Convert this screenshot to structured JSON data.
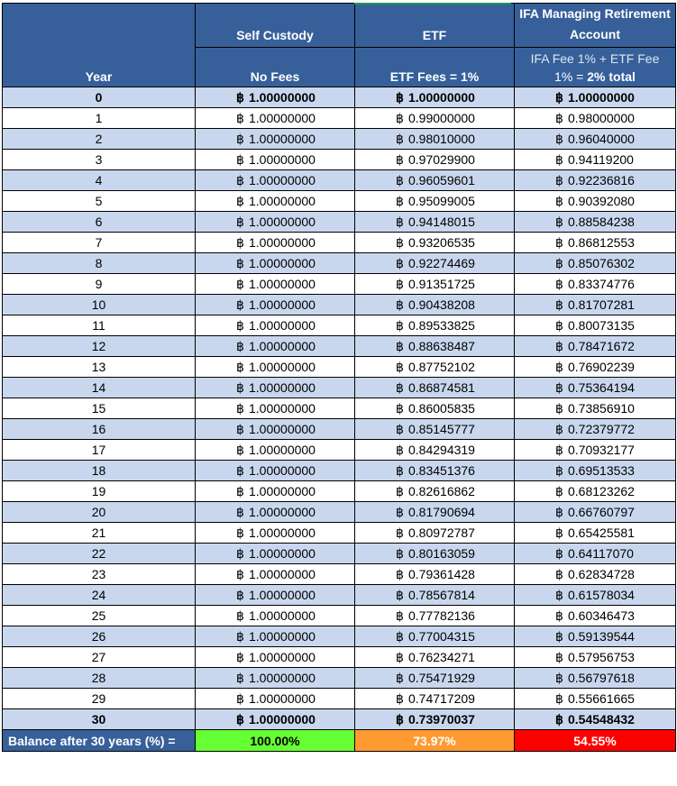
{
  "headers": {
    "year": "Year",
    "self_custody": "Self Custody",
    "self_custody_sub": "No Fees",
    "etf": "ETF",
    "etf_sub": "ETF Fees = 1%",
    "ifa": "IFA Managing Retirement Account",
    "ifa_sub_a": "IFA Fee 1% + ETF Fee",
    "ifa_sub_b": "1% = ",
    "ifa_sub_bold": "2% total"
  },
  "currency_symbol": "฿",
  "rows": [
    {
      "year": "0",
      "self": "1.00000000",
      "etf": "1.00000000",
      "ifa": "1.00000000"
    },
    {
      "year": "1",
      "self": "1.00000000",
      "etf": "0.99000000",
      "ifa": "0.98000000"
    },
    {
      "year": "2",
      "self": "1.00000000",
      "etf": "0.98010000",
      "ifa": "0.96040000"
    },
    {
      "year": "3",
      "self": "1.00000000",
      "etf": "0.97029900",
      "ifa": "0.94119200"
    },
    {
      "year": "4",
      "self": "1.00000000",
      "etf": "0.96059601",
      "ifa": "0.92236816"
    },
    {
      "year": "5",
      "self": "1.00000000",
      "etf": "0.95099005",
      "ifa": "0.90392080"
    },
    {
      "year": "6",
      "self": "1.00000000",
      "etf": "0.94148015",
      "ifa": "0.88584238"
    },
    {
      "year": "7",
      "self": "1.00000000",
      "etf": "0.93206535",
      "ifa": "0.86812553"
    },
    {
      "year": "8",
      "self": "1.00000000",
      "etf": "0.92274469",
      "ifa": "0.85076302"
    },
    {
      "year": "9",
      "self": "1.00000000",
      "etf": "0.91351725",
      "ifa": "0.83374776"
    },
    {
      "year": "10",
      "self": "1.00000000",
      "etf": "0.90438208",
      "ifa": "0.81707281"
    },
    {
      "year": "11",
      "self": "1.00000000",
      "etf": "0.89533825",
      "ifa": "0.80073135"
    },
    {
      "year": "12",
      "self": "1.00000000",
      "etf": "0.88638487",
      "ifa": "0.78471672"
    },
    {
      "year": "13",
      "self": "1.00000000",
      "etf": "0.87752102",
      "ifa": "0.76902239"
    },
    {
      "year": "14",
      "self": "1.00000000",
      "etf": "0.86874581",
      "ifa": "0.75364194"
    },
    {
      "year": "15",
      "self": "1.00000000",
      "etf": "0.86005835",
      "ifa": "0.73856910"
    },
    {
      "year": "16",
      "self": "1.00000000",
      "etf": "0.85145777",
      "ifa": "0.72379772"
    },
    {
      "year": "17",
      "self": "1.00000000",
      "etf": "0.84294319",
      "ifa": "0.70932177"
    },
    {
      "year": "18",
      "self": "1.00000000",
      "etf": "0.83451376",
      "ifa": "0.69513533"
    },
    {
      "year": "19",
      "self": "1.00000000",
      "etf": "0.82616862",
      "ifa": "0.68123262"
    },
    {
      "year": "20",
      "self": "1.00000000",
      "etf": "0.81790694",
      "ifa": "0.66760797"
    },
    {
      "year": "21",
      "self": "1.00000000",
      "etf": "0.80972787",
      "ifa": "0.65425581"
    },
    {
      "year": "22",
      "self": "1.00000000",
      "etf": "0.80163059",
      "ifa": "0.64117070"
    },
    {
      "year": "23",
      "self": "1.00000000",
      "etf": "0.79361428",
      "ifa": "0.62834728"
    },
    {
      "year": "24",
      "self": "1.00000000",
      "etf": "0.78567814",
      "ifa": "0.61578034"
    },
    {
      "year": "25",
      "self": "1.00000000",
      "etf": "0.77782136",
      "ifa": "0.60346473"
    },
    {
      "year": "26",
      "self": "1.00000000",
      "etf": "0.77004315",
      "ifa": "0.59139544"
    },
    {
      "year": "27",
      "self": "1.00000000",
      "etf": "0.76234271",
      "ifa": "0.57956753"
    },
    {
      "year": "28",
      "self": "1.00000000",
      "etf": "0.75471929",
      "ifa": "0.56797618"
    },
    {
      "year": "29",
      "self": "1.00000000",
      "etf": "0.74717209",
      "ifa": "0.55661665"
    },
    {
      "year": "30",
      "self": "1.00000000",
      "etf": "0.73970037",
      "ifa": "0.54548432"
    }
  ],
  "bold_years": [
    "0",
    "30"
  ],
  "total": {
    "label": "Balance after 30 years (%) =",
    "self": "100.00%",
    "etf": "73.97%",
    "ifa": "54.55%"
  },
  "colors": {
    "header_blue": "#37609a",
    "stripe_blue": "#c9d7ee",
    "green": "#66ff33",
    "orange": "#ff9a33",
    "red": "#ff0000"
  }
}
